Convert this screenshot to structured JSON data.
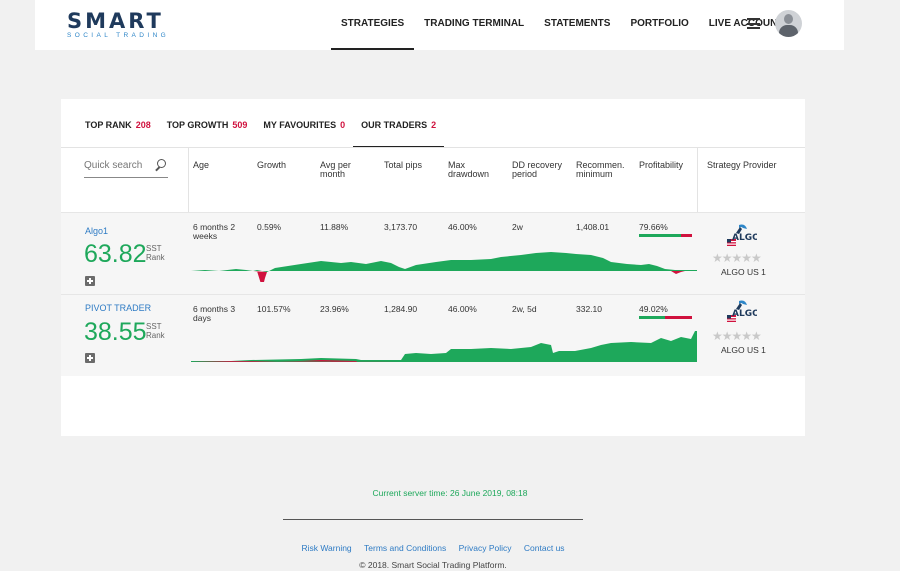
{
  "header": {
    "logo_main": "SMART",
    "logo_sub": "SOCIAL TRADING",
    "nav": [
      "STRATEGIES",
      "TRADING TERMINAL",
      "STATEMENTS",
      "PORTFOLIO",
      "LIVE ACCOUNT"
    ],
    "active_nav": "STRATEGIES"
  },
  "tabs": [
    {
      "label": "TOP RANK",
      "count": "208"
    },
    {
      "label": "TOP GROWTH",
      "count": "509"
    },
    {
      "label": "MY FAVOURITES",
      "count": "0"
    },
    {
      "label": "OUR TRADERS",
      "count": "2",
      "active": true
    }
  ],
  "search": {
    "placeholder": "Quick search"
  },
  "columns": [
    "Age",
    "Growth",
    "Avg per\nmonth",
    "Total pips",
    "Max\ndrawdown",
    "DD recovery\nperiod",
    "Recommen.\nminimum",
    "Profitability",
    "Strategy Provider"
  ],
  "rank_label": "SST\nRank",
  "rows": [
    {
      "name": "Algo1",
      "rank": "63.82",
      "age": "6 months 2\nweeks",
      "growth": "0.59%",
      "avg_per_month": "11.88%",
      "total_pips": "3,173.70",
      "max_drawdown": "46.00%",
      "dd_recovery": "2w",
      "rec_minimum": "1,408.01",
      "profitability": "79.66%",
      "profitability_value": 0.7966,
      "provider": "ALGO US 1",
      "provider_logo": "ALGO",
      "stars": "★★★★★"
    },
    {
      "name": "PIVOT TRADER",
      "rank": "38.55",
      "age": "6 months 3\ndays",
      "growth": "101.57%",
      "avg_per_month": "23.96%",
      "total_pips": "1,284.90",
      "max_drawdown": "46.00%",
      "dd_recovery": "2w, 5d",
      "rec_minimum": "332.10",
      "profitability": "49.02%",
      "profitability_value": 0.4902,
      "provider": "ALGO US 1",
      "provider_logo": "ALGO",
      "stars": "★★★★★"
    }
  ],
  "footer": {
    "server_time": "Current server time: 26 June 2019, 08:18",
    "links": [
      "Risk Warning",
      "Terms and Conditions",
      "Privacy Policy",
      "Contact us"
    ],
    "copyright": "© 2018. Smart Social Trading Platform."
  },
  "colors": {
    "positive": "#1ea85b",
    "negative": "#d0123e",
    "link": "#2e7bc4"
  }
}
